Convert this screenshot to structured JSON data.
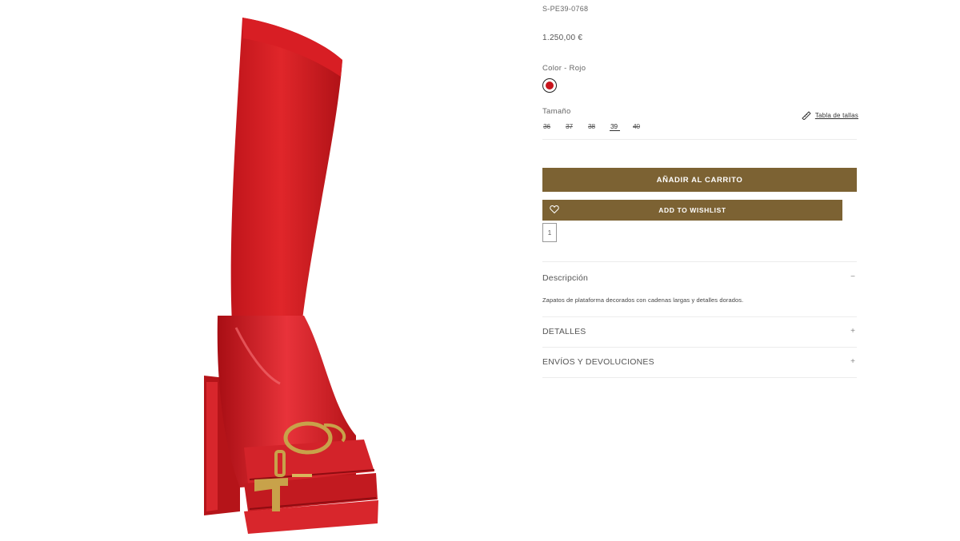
{
  "product": {
    "sku": "S-PE39-0768",
    "price": "1.250,00 €",
    "color_label": "Color - Rojo",
    "color_hex": "#c8141c",
    "size_label": "Tamaño",
    "size_guide_label": "Tabla de tallas",
    "sizes": [
      {
        "label": "36",
        "available": false
      },
      {
        "label": "37",
        "available": false
      },
      {
        "label": "38",
        "available": false
      },
      {
        "label": "39",
        "available": true
      },
      {
        "label": "40",
        "available": false
      }
    ],
    "quantity": "1"
  },
  "actions": {
    "add_to_cart": "AÑADIR AL CARRITO",
    "add_to_wishlist": "ADD TO WISHLIST",
    "accent_color": "#7c6233"
  },
  "accordion": {
    "description": {
      "title": "Descripción",
      "toggle": "−",
      "text": "Zapatos de plataforma decorados con cadenas largas y detalles dorados."
    },
    "details": {
      "title": "DETALLES",
      "toggle": "+"
    },
    "shipping": {
      "title": "ENVÍOS Y DEVOLUCIONES",
      "toggle": "+"
    }
  },
  "image": {
    "subject": "red knee-high platform boot with gold chain hardware"
  }
}
